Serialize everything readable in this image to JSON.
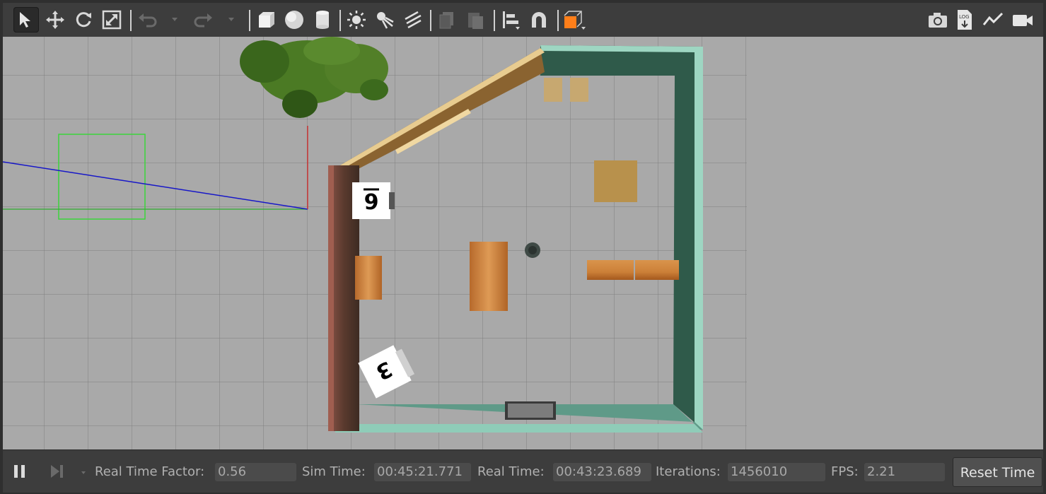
{
  "toolbar": {
    "left_tools": [
      "select-mode",
      "translate-mode",
      "rotate-mode",
      "scale-mode",
      "undo",
      "redo"
    ],
    "shapes": [
      "box",
      "sphere",
      "cylinder"
    ],
    "lights": [
      "point-light",
      "spot-light",
      "directional-light"
    ],
    "right_tools": [
      "screenshot",
      "log",
      "plot",
      "record-video"
    ],
    "accent_color": "#ff7f1a",
    "log_icon_text": "LOG"
  },
  "viewport": {
    "cube_top_label": "6",
    "cube_bottom_label": "3"
  },
  "statusbar": {
    "real_time_factor_label": "Real Time Factor:",
    "real_time_factor_value": "0.56",
    "sim_time_label": "Sim Time:",
    "sim_time_value": "00:45:21.771",
    "real_time_label": "Real Time:",
    "real_time_value": "00:43:23.689",
    "iterations_label": "Iterations:",
    "iterations_value": "1456010",
    "fps_label": "FPS:",
    "fps_value": "2.21",
    "reset_label": "Reset Time"
  }
}
